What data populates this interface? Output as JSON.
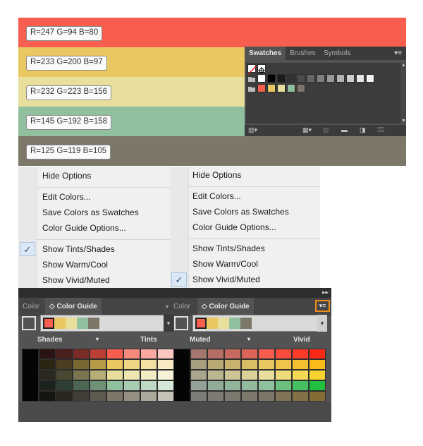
{
  "stripes": [
    {
      "label": "R=247 G=94 B=80",
      "color": "#f75e50"
    },
    {
      "label": "R=233 G=200 B=97",
      "color": "#e9c861"
    },
    {
      "label": "R=232 G=223 B=156",
      "color": "#e8df9c"
    },
    {
      "label": "R=145 G=192 B=158",
      "color": "#91c09e"
    },
    {
      "label": "R=125 G=119 B=105",
      "color": "#7d7769"
    }
  ],
  "swatches_panel": {
    "tabs": [
      "Swatches",
      "Brushes",
      "Symbols"
    ],
    "row1": [
      "#ffffff",
      "#000000",
      "#1a1a1a",
      "#333333",
      "#4d4d4d",
      "#666666",
      "#808080",
      "#999999",
      "#b3b3b3",
      "#cccccc",
      "#e6e6e6",
      "#f2f2f2"
    ],
    "row2": [
      "#f75e50",
      "#e9c861",
      "#e8df9c",
      "#91c09e",
      "#7d7769"
    ]
  },
  "menu_left": {
    "items": [
      "Hide Options",
      "Edit Colors...",
      "Save Colors as Swatches",
      "Color Guide Options...",
      "Show Tints/Shades",
      "Show Warm/Cool",
      "Show Vivid/Muted"
    ],
    "check_symbol": "✓"
  },
  "menu_right": {
    "items": [
      "Hide Options",
      "Edit Colors...",
      "Save Colors as Swatches",
      "Color Guide Options...",
      "Show Tints/Shades",
      "Show Warm/Cool",
      "Show Vivid/Muted"
    ],
    "check_symbol": "✓"
  },
  "color_guide": {
    "left": {
      "tab_color": "Color",
      "tab_guide": "Color Guide",
      "left_header": "Shades",
      "right_header": "Tints"
    },
    "right": {
      "tab_color": "Color",
      "tab_guide": "Color Guide",
      "left_header": "Muted",
      "right_header": "Vivid"
    },
    "group": [
      "#f75e50",
      "#e9c861",
      "#e8df9c",
      "#91c09e",
      "#7d7769"
    ],
    "collapse_icon_text": "▸▸",
    "menu_icon_text": "▾≡",
    "shades_grid": [
      [
        "#2a1413",
        "#4a1f1c",
        "#7a2c27",
        "#b83e36",
        "#f75e50",
        "#f88a7e",
        "#faa9a0",
        "#fbc8c1",
        "#fde3df"
      ],
      [
        "#2a2513",
        "#4a3f20",
        "#7a6833",
        "#b79b49",
        "#e9c861",
        "#efd684",
        "#f3e0a3",
        "#f7eac2",
        "#fbf4e0"
      ],
      [
        "#2a2920",
        "#4a4733",
        "#7a7450",
        "#b7ad76",
        "#e8df9c",
        "#ede6b1",
        "#f1ecc4",
        "#f6f2d8",
        "#faf8eb"
      ],
      [
        "#1a221c",
        "#2f3e33",
        "#4d6553",
        "#6f9178",
        "#91c09e",
        "#a9cdb2",
        "#bed9c4",
        "#d3e6d7",
        "#e9f2ea"
      ],
      [
        "#161512",
        "#28261f",
        "#423e35",
        "#5f5a4f",
        "#7d7769",
        "#959081",
        "#aca89c",
        "#c5c2b8",
        "#e1dfda"
      ]
    ],
    "vivid_grid": [
      [
        "#8a8a8a",
        "#a3776f",
        "#b56e65",
        "#c96a5e",
        "#db6458",
        "#f75e50",
        "#f94c3d",
        "#fb3a2a",
        "#fd2818"
      ],
      [
        "#8c8a82",
        "#a89f7e",
        "#b8a873",
        "#c9b26c",
        "#d9bc66",
        "#e9c861",
        "#efc449",
        "#f4bf31",
        "#f9bb19"
      ],
      [
        "#8e8d86",
        "#aaa68e",
        "#bbb590",
        "#ccc495",
        "#dad299",
        "#e8df9c",
        "#eedb78",
        "#f3d854",
        "#f9d430"
      ],
      [
        "#8a8b8a",
        "#93a198",
        "#91ab97",
        "#92b49b",
        "#92ba9d",
        "#91c09e",
        "#6cc07f",
        "#46c060",
        "#21c041"
      ],
      [
        "#808080",
        "#7e7c78",
        "#7e7a72",
        "#7d796e",
        "#7d786b",
        "#7d7769",
        "#7f7458",
        "#827047",
        "#846c36"
      ]
    ]
  }
}
